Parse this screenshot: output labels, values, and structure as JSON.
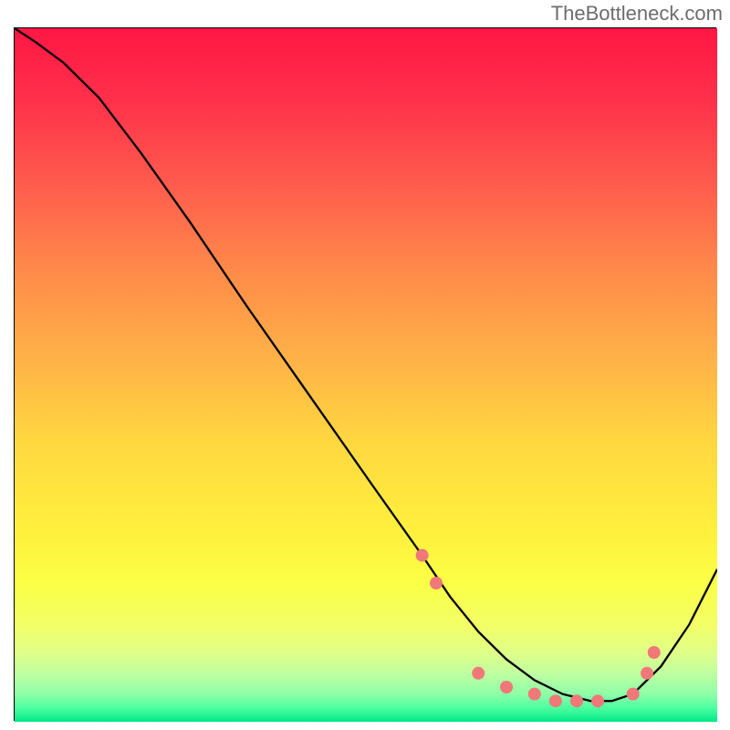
{
  "attribution": "TheBottleneck.com",
  "chart_data": {
    "type": "line",
    "title": "",
    "xlabel": "",
    "ylabel": "",
    "xlim": [
      0,
      100
    ],
    "ylim": [
      0,
      100
    ],
    "grid": false,
    "curve": {
      "x": [
        0,
        3,
        7,
        12,
        18,
        25,
        33,
        42,
        51,
        58,
        62,
        66,
        70,
        74,
        78,
        82,
        85,
        88,
        92,
        96,
        100
      ],
      "y": [
        100,
        98,
        95,
        90,
        82,
        72,
        60,
        47,
        34,
        24,
        18,
        13,
        9,
        6,
        4,
        3,
        3,
        4,
        8,
        14,
        22
      ]
    },
    "markers": {
      "x": [
        58,
        60,
        66,
        70,
        74,
        77,
        80,
        83,
        88,
        90,
        91
      ],
      "y": [
        24,
        20,
        7,
        5,
        4,
        3,
        3,
        3,
        4,
        7,
        10
      ],
      "color": "#f07878",
      "radius": 7
    },
    "colors": {
      "line": "#000000",
      "gradient_top": "#ff1744",
      "gradient_mid": "#ffe13d",
      "gradient_bottom": "#00e887"
    }
  }
}
